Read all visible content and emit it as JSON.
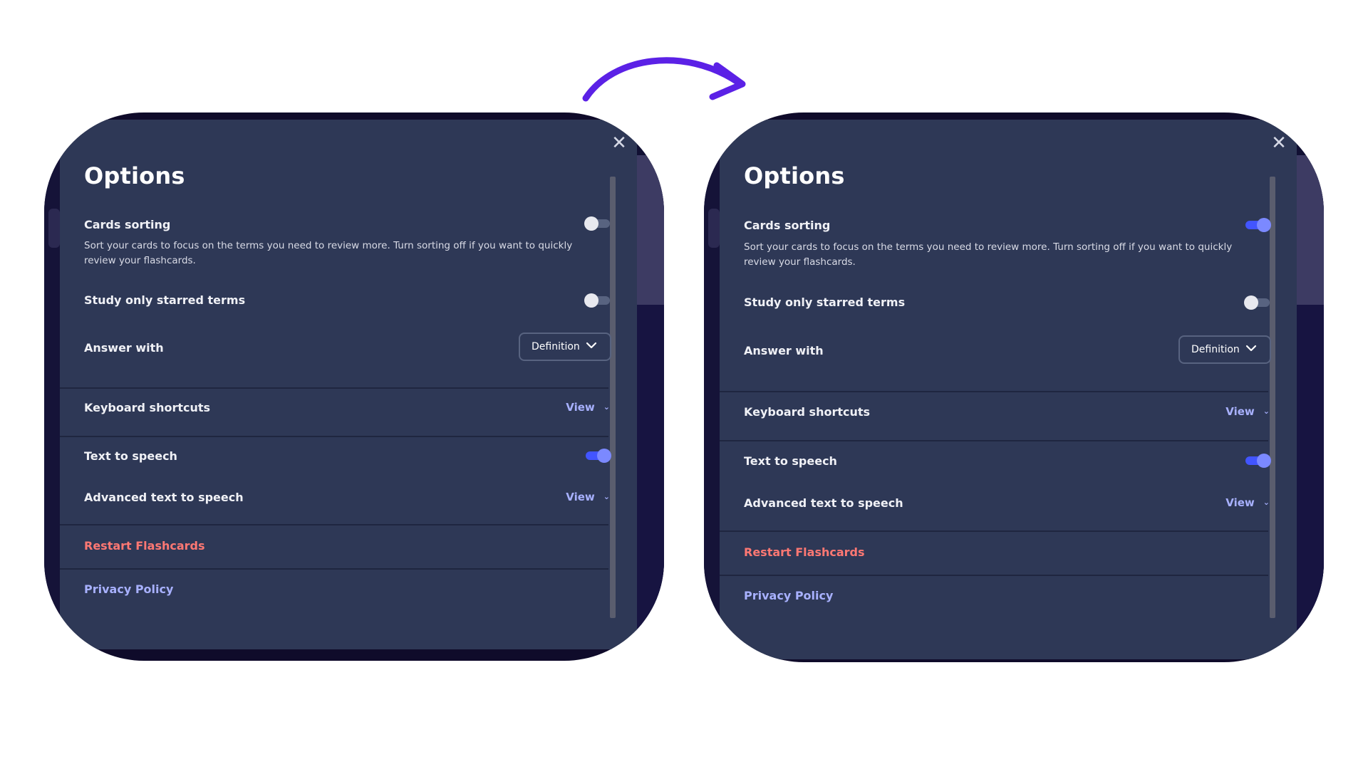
{
  "colors": {
    "accent_arrow": "#5b21e6",
    "modal_bg": "#2e3856",
    "toggle_on": "#4255ff",
    "link_red": "#ff7873",
    "link_blue": "#a8b1ff"
  },
  "panels": [
    {
      "state": "before",
      "title": "Options",
      "close_icon": "close-icon",
      "cards_sorting": {
        "label": "Cards sorting",
        "description": "Sort your cards to focus on the terms you need to review more. Turn sorting off if you want to quickly review your flashcards.",
        "enabled": false
      },
      "starred": {
        "label": "Study only starred terms",
        "enabled": false
      },
      "answer_with": {
        "label": "Answer with",
        "value": "Definition"
      },
      "keyboard_shortcuts": {
        "label": "Keyboard shortcuts",
        "action": "View"
      },
      "tts": {
        "label": "Text to speech",
        "enabled": true
      },
      "advanced_tts": {
        "label": "Advanced text to speech",
        "action": "View"
      },
      "restart": "Restart Flashcards",
      "privacy": "Privacy Policy"
    },
    {
      "state": "after",
      "title": "Options",
      "close_icon": "close-icon",
      "cards_sorting": {
        "label": "Cards sorting",
        "description": "Sort your cards to focus on the terms you need to review more. Turn sorting off if you want to quickly review your flashcards.",
        "enabled": true
      },
      "starred": {
        "label": "Study only starred terms",
        "enabled": false
      },
      "answer_with": {
        "label": "Answer with",
        "value": "Definition"
      },
      "keyboard_shortcuts": {
        "label": "Keyboard shortcuts",
        "action": "View"
      },
      "tts": {
        "label": "Text to speech",
        "enabled": true
      },
      "advanced_tts": {
        "label": "Advanced text to speech",
        "action": "View"
      },
      "restart": "Restart Flashcards",
      "privacy": "Privacy Policy"
    }
  ]
}
